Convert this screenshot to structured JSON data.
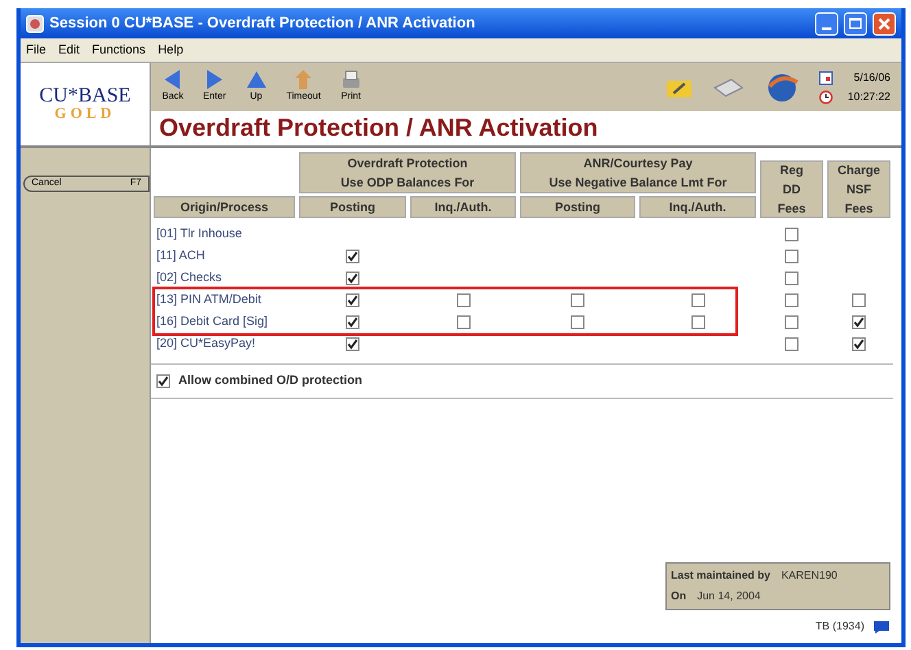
{
  "window": {
    "title": "Session 0 CU*BASE - Overdraft Protection / ANR Activation"
  },
  "menu": [
    "File",
    "Edit",
    "Functions",
    "Help"
  ],
  "toolbar": [
    {
      "label": "Back",
      "kind": "back"
    },
    {
      "label": "Enter",
      "kind": "enter"
    },
    {
      "label": "Up",
      "kind": "up"
    },
    {
      "label": "Timeout",
      "kind": "timeout"
    },
    {
      "label": "Print",
      "kind": "print"
    }
  ],
  "date": "5/16/06",
  "time": "10:27:22",
  "logo": {
    "top": "CU*BASE",
    "bottom": "GOLD"
  },
  "heading": "Overdraft Protection / ANR Activation",
  "sidebar": {
    "button": "Cancel",
    "key": "F7"
  },
  "groups": [
    {
      "line1": "Overdraft Protection",
      "line2": "Use ODP Balances For"
    },
    {
      "line1": "ANR/Courtesy Pay",
      "line2": "Use Negative Balance Lmt For"
    }
  ],
  "columns": [
    "Origin/Process",
    "Posting",
    "Inq./Auth.",
    "Posting",
    "Inq./Auth.",
    "Reg DD Fees",
    "Charge NSF Fees"
  ],
  "row_groups": [
    {
      "highlighted": false,
      "rows": [
        {
          "label": "[01] Tlr Inhouse",
          "cells": [
            null,
            null,
            null,
            null,
            {
              "checked": false
            },
            null
          ]
        },
        {
          "label": "[11] ACH",
          "cells": [
            {
              "checked": true
            },
            null,
            null,
            null,
            {
              "checked": false
            },
            null
          ]
        },
        {
          "label": "[02] Checks",
          "cells": [
            {
              "checked": true
            },
            null,
            null,
            null,
            {
              "checked": false
            },
            null
          ]
        }
      ]
    },
    {
      "highlighted": true,
      "rows": [
        {
          "label": "[13] PIN ATM/Debit",
          "cells": [
            {
              "checked": true
            },
            {
              "checked": false
            },
            {
              "checked": false
            },
            {
              "checked": false
            },
            {
              "checked": false
            },
            {
              "checked": false
            }
          ]
        },
        {
          "label": "[16] Debit Card [Sig]",
          "cells": [
            {
              "checked": true
            },
            {
              "checked": false
            },
            {
              "checked": false
            },
            {
              "checked": false
            },
            {
              "checked": false
            },
            {
              "checked": true
            }
          ]
        }
      ]
    },
    {
      "highlighted": false,
      "rows": [
        {
          "label": "[20] CU*EasyPay!",
          "cells": [
            {
              "checked": true
            },
            null,
            null,
            null,
            {
              "checked": false
            },
            {
              "checked": true
            }
          ]
        }
      ]
    }
  ],
  "combined": {
    "label": "Allow combined O/D protection",
    "checked": true
  },
  "maintained": {
    "by_label": "Last maintained by",
    "by": "KAREN190",
    "on_label": "On",
    "on": "Jun 14, 2004"
  },
  "status": "TB (1934)"
}
